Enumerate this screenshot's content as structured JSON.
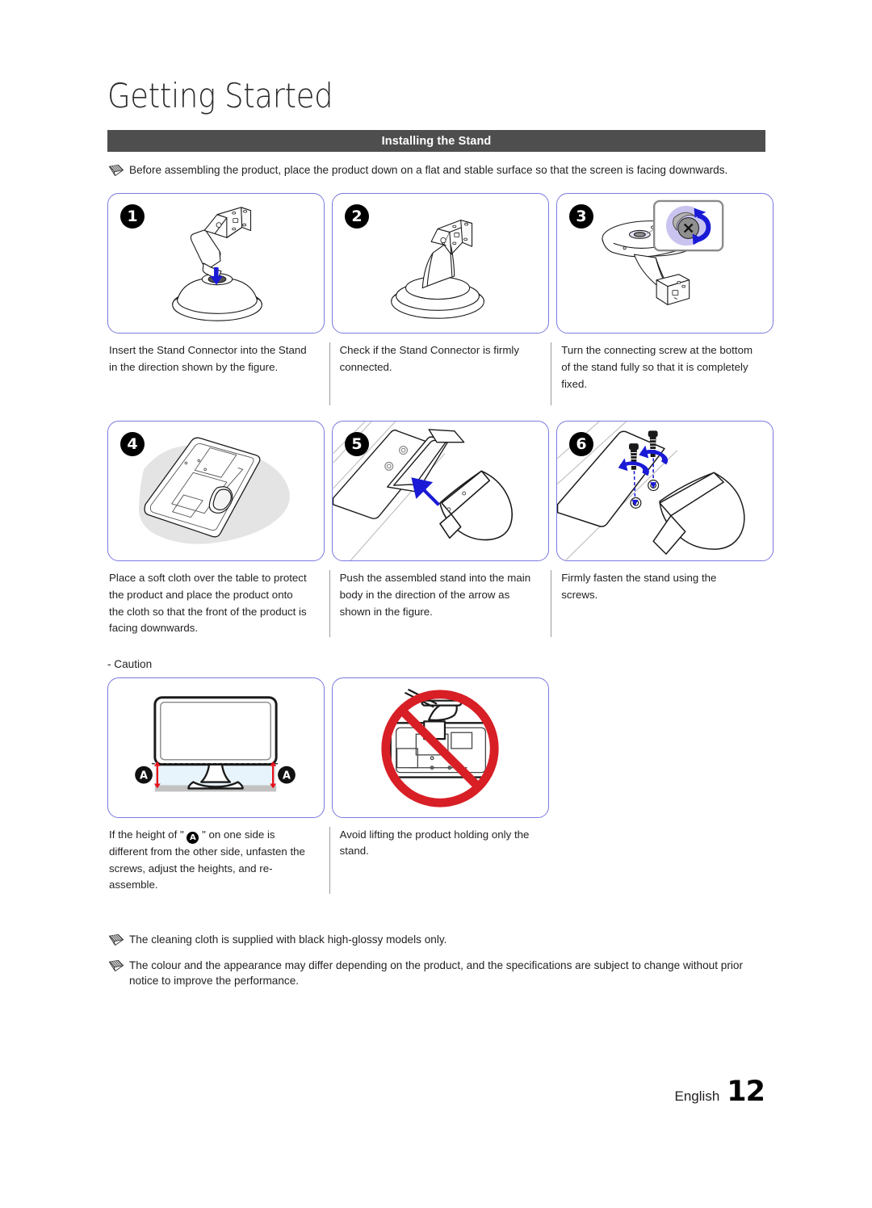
{
  "document": {
    "title": "Getting Started",
    "section_header": "Installing the Stand"
  },
  "intro_note": {
    "icon": "pencil-note-icon",
    "text": "Before assembling the product, place the product down on a flat and stable surface so that the screen is facing downwards."
  },
  "steps": [
    {
      "number": "1",
      "figure": "stand-connector-insert-into-base",
      "caption": "Insert the Stand Connector into the Stand in the direction shown by the figure."
    },
    {
      "number": "2",
      "figure": "assembled-stand-check",
      "caption": "Check if the Stand Connector is firmly connected."
    },
    {
      "number": "3",
      "figure": "tighten-connecting-screw-underside",
      "caption": "Turn the connecting screw at the bottom of the stand fully so that it is completely fixed."
    },
    {
      "number": "4",
      "figure": "monitor-face-down-on-cloth",
      "caption": "Place a soft cloth over the table to protect the product and place the product onto the cloth so that the front of the product is facing downwards."
    },
    {
      "number": "5",
      "figure": "push-stand-into-main-body",
      "caption": "Push the assembled stand into the main body in the direction of the arrow as shown in the figure."
    },
    {
      "number": "6",
      "figure": "fasten-stand-with-screws",
      "caption": "Firmly fasten the stand using the screws."
    }
  ],
  "caution": {
    "label": "- Caution",
    "items": [
      {
        "figure": "monitor-height-measure-A",
        "marker": "A",
        "caption_part1": "If the height of \" ",
        "caption_part2": " \" on one side is different from the other side, unfasten the screws, adjust the heights, and re-assemble."
      },
      {
        "figure": "do-not-lift-by-stand-prohibited",
        "caption": "Avoid lifting the product holding only the stand."
      }
    ]
  },
  "bottom_notes": [
    {
      "icon": "pencil-note-icon",
      "text": "The cleaning cloth is supplied with black high-glossy models only."
    },
    {
      "icon": "pencil-note-icon",
      "text": "The colour and the appearance may differ depending on the product, and the specifications are subject to change without prior notice to improve the performance."
    }
  ],
  "footer": {
    "language": "English",
    "page_number": "12"
  },
  "colors": {
    "band_background": "#4e4e4e",
    "figure_border": "#7b79e0",
    "arrow_blue": "#1a1ad6",
    "prohibition_red": "#d81f26",
    "measure_red": "#e8121a",
    "cloth_gray": "#e2e2e2",
    "badge_black": "#000000"
  }
}
